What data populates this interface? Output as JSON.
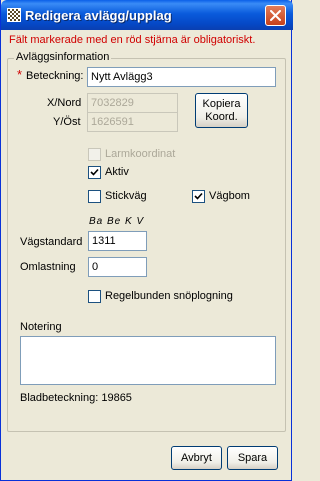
{
  "window": {
    "title": "Redigera avlägg/upplag"
  },
  "icons": {
    "app": "grid-icon",
    "close": "close-icon",
    "check": "check-icon"
  },
  "colors": {
    "required": "#d00000",
    "titlebar": "#0a5bdc"
  },
  "warning": "Fält markerade med en röd stjärna är obligatoriskt.",
  "group": {
    "legend": "Avläggsinformation"
  },
  "fields": {
    "beteckning": {
      "required_mark": "*",
      "label": "Beteckning:",
      "value": "Nytt Avlägg3"
    },
    "x_nord": {
      "label": "X/Nord",
      "value": "7032829"
    },
    "y_ost": {
      "label": "Y/Öst",
      "value": "1626591"
    },
    "vagstandard": {
      "label": "Vägstandard",
      "hint": "Ba Be K V",
      "value": "1311"
    },
    "omlastning": {
      "label": "Omlastning",
      "value": "0"
    }
  },
  "buttons": {
    "kopiera_line1": "Kopiera",
    "kopiera_line2": "Koord.",
    "avbryt": "Avbryt",
    "spara": "Spara"
  },
  "checkboxes": {
    "larmkoordinat": {
      "label": "Larmkoordinat",
      "checked": false,
      "enabled": false
    },
    "aktiv": {
      "label": "Aktiv",
      "checked": true,
      "enabled": true
    },
    "stickvag": {
      "label": "Stickväg",
      "checked": false,
      "enabled": true
    },
    "vagbom": {
      "label": "Vägbom",
      "checked": true,
      "enabled": true
    },
    "snoplogning": {
      "label": "Regelbunden snöplogning",
      "checked": false,
      "enabled": true
    }
  },
  "notering": {
    "label": "Notering",
    "value": ""
  },
  "bladbeteckning": "Bladbeteckning: 19865"
}
